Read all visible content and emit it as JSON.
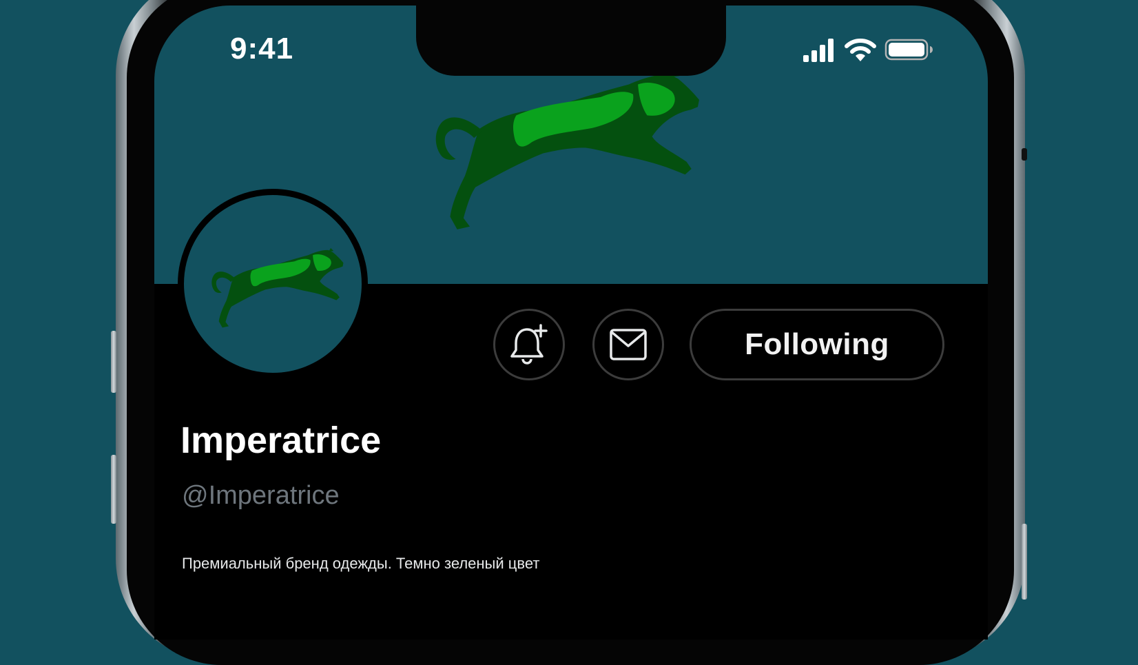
{
  "status_bar": {
    "time": "9:41"
  },
  "profile": {
    "display_name": "Imperatrice",
    "handle": "@Imperatrice",
    "bio": "Премиальный бренд одежды. Темно зеленый цвет"
  },
  "actions": {
    "following_label": "Following"
  },
  "icons": {
    "signal": "cellular-signal-icon",
    "wifi": "wifi-icon",
    "battery": "battery-icon",
    "notify": "bell-plus-icon",
    "message": "envelope-icon",
    "brand": "panther-logo"
  },
  "colors": {
    "banner": "#12515f",
    "panther_dark": "#04500f",
    "panther_light": "#0aa21d",
    "screen_bg": "#000000"
  }
}
